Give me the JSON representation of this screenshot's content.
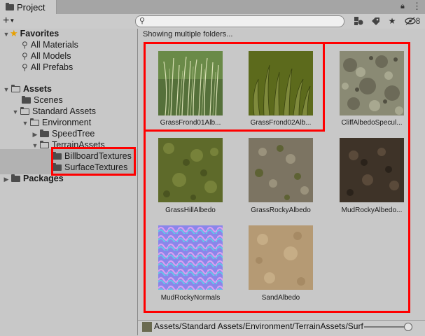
{
  "window": {
    "tab_label": "Project",
    "hidden_count": "8"
  },
  "toolbar": {
    "create_label": "+",
    "search_placeholder": ""
  },
  "tree": {
    "favorites": {
      "label": "Favorites",
      "items": [
        "All Materials",
        "All Models",
        "All Prefabs"
      ]
    },
    "assets": {
      "label": "Assets",
      "scenes": "Scenes",
      "standard_assets": "Standard Assets",
      "environment": "Environment",
      "speedtree": "SpeedTree",
      "terrain_assets": "TerrainAssets",
      "billboard_textures": "BillboardTextures",
      "surface_textures": "SurfaceTextures"
    },
    "packages": "Packages"
  },
  "grid": {
    "status": "Showing multiple folders...",
    "items": [
      {
        "label": "GrassFrond01Alb...",
        "texture": "grass-frond-1"
      },
      {
        "label": "GrassFrond02Alb...",
        "texture": "grass-frond-2"
      },
      {
        "label": "CliffAlbedoSpecul...",
        "texture": "cliff"
      },
      {
        "label": "GrassHillAlbedo",
        "texture": "grass-hill"
      },
      {
        "label": "GrassRockyAlbedo",
        "texture": "grass-rocky"
      },
      {
        "label": "MudRockyAlbedo...",
        "texture": "mud-rocky"
      },
      {
        "label": "MudRockyNormals",
        "texture": "normals"
      },
      {
        "label": "SandAlbedo",
        "texture": "sand"
      }
    ]
  },
  "path_bar": {
    "path": "Assets/Standard Assets/Environment/TerrainAssets/Surf"
  },
  "colors": {
    "highlight": "#ff0000",
    "favorites_star": "#e8a000"
  }
}
